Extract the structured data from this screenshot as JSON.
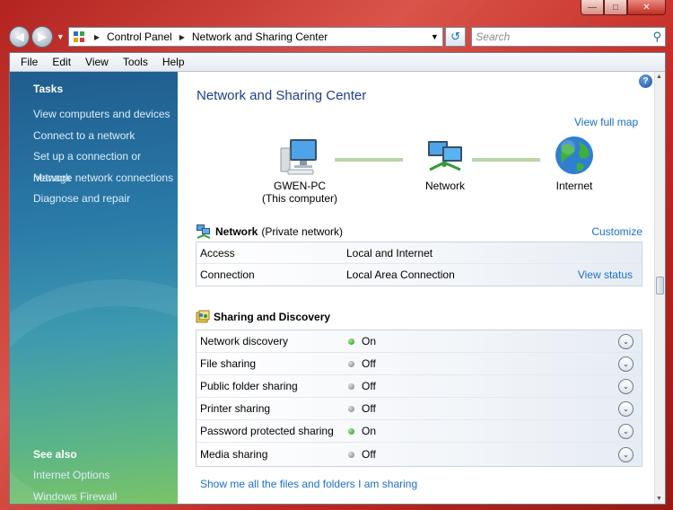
{
  "window": {
    "minimize_icon": "minimize-icon",
    "maximize_icon": "maximize-icon",
    "close_icon": "close-icon"
  },
  "address": {
    "crumbs": [
      "Control Panel",
      "Network and Sharing Center"
    ],
    "search_placeholder": "Search"
  },
  "menu": [
    "File",
    "Edit",
    "View",
    "Tools",
    "Help"
  ],
  "sidebar": {
    "tasks_heading": "Tasks",
    "tasks": [
      "View computers and devices",
      "Connect to a network",
      "Set up a connection or network",
      "Manage network connections",
      "Diagnose and repair"
    ],
    "see_also_heading": "See also",
    "see_also": [
      "Internet Options",
      "Windows Firewall"
    ]
  },
  "main": {
    "title": "Network and Sharing Center",
    "view_full_map": "View full map",
    "map": {
      "computer_name": "GWEN-PC",
      "computer_sub": "(This computer)",
      "network": "Network",
      "internet": "Internet"
    },
    "network_section": {
      "name": "Network",
      "type": "(Private network)",
      "customize": "Customize",
      "rows": [
        {
          "key": "Access",
          "value": "Local and Internet",
          "action": ""
        },
        {
          "key": "Connection",
          "value": "Local Area Connection",
          "action": "View status"
        }
      ]
    },
    "sharing_section": {
      "title": "Sharing and Discovery",
      "rows": [
        {
          "key": "Network discovery",
          "status": "On"
        },
        {
          "key": "File sharing",
          "status": "Off"
        },
        {
          "key": "Public folder sharing",
          "status": "Off"
        },
        {
          "key": "Printer sharing",
          "status": "Off"
        },
        {
          "key": "Password protected sharing",
          "status": "On"
        },
        {
          "key": "Media sharing",
          "status": "Off"
        }
      ]
    },
    "bottom_link": "Show me all the files and folders I am sharing"
  },
  "colors": {
    "link": "#1a6fc7",
    "title": "#1e3f8a",
    "status_on": "#1f8d1a",
    "status_off": "#777777"
  }
}
